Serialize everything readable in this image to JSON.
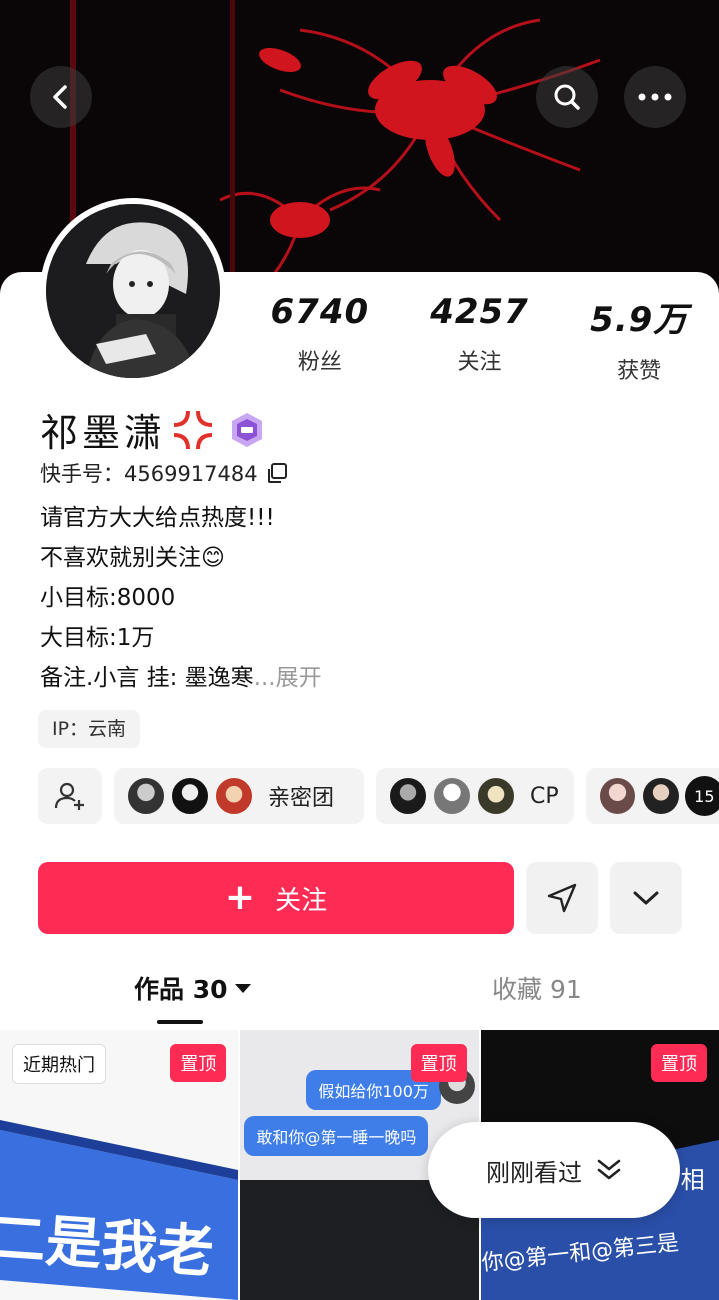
{
  "profile": {
    "name": "祁墨潇",
    "kuaishou_id": "快手号：4569917484",
    "stats": [
      {
        "value": "6740",
        "label": "粉丝"
      },
      {
        "value": "4257",
        "label": "关注"
      },
      {
        "value": "5.9万",
        "label": "获赞"
      }
    ],
    "bio_lines": [
      "请官方大大给点热度!!!",
      "不喜欢就别关注😊",
      "小目标:8000",
      "大目标:1万"
    ],
    "bio_last_line": "备注.小言 挂: 墨逸寒",
    "bio_more": "...展开",
    "ip": "IP：云南"
  },
  "groups": [
    {
      "label": "亲密团"
    },
    {
      "label": "CP"
    },
    {
      "count": "15"
    }
  ],
  "actions": {
    "follow_label": "关注",
    "follow_plus": "+"
  },
  "tabs": {
    "works": "作品 30",
    "favorites": "收藏 91"
  },
  "grid": {
    "hot_tag": "近期热门",
    "pin_tag": "置顶",
    "cell1_text": "二是我老",
    "cell2_bubble1": "假如给你100万",
    "cell2_bubble2": "敢和你@第一睡一晚吗",
    "cell3_text1": "相",
    "cell3_text2": "你@第一和@第三是"
  },
  "recent": {
    "label": "刚刚看过"
  },
  "colors": {
    "accent": "#fe2c55",
    "banner_flower": "#d0151e"
  },
  "icons": [
    "back-icon",
    "search-icon",
    "more-dots-icon",
    "copy-icon",
    "add-friend-icon",
    "share-send-icon",
    "chevron-down-icon",
    "double-chevron-down-icon",
    "caret-down-icon",
    "anger-icon",
    "level-badge-icon"
  ]
}
